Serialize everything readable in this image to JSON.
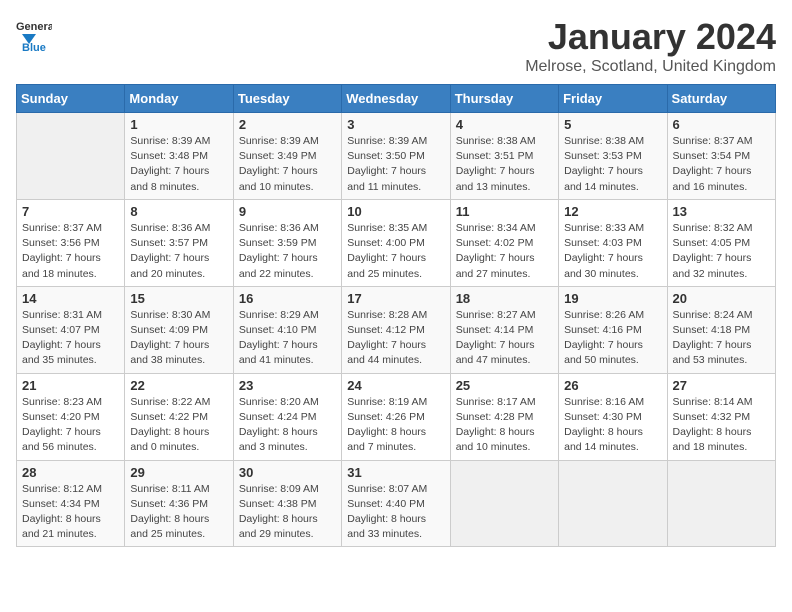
{
  "logo": {
    "text_general": "General",
    "text_blue": "Blue"
  },
  "header": {
    "month_title": "January 2024",
    "location": "Melrose, Scotland, United Kingdom"
  },
  "weekdays": [
    "Sunday",
    "Monday",
    "Tuesday",
    "Wednesday",
    "Thursday",
    "Friday",
    "Saturday"
  ],
  "weeks": [
    [
      {
        "day": "",
        "sunrise": "",
        "sunset": "",
        "daylight": ""
      },
      {
        "day": "1",
        "sunrise": "Sunrise: 8:39 AM",
        "sunset": "Sunset: 3:48 PM",
        "daylight": "Daylight: 7 hours and 8 minutes."
      },
      {
        "day": "2",
        "sunrise": "Sunrise: 8:39 AM",
        "sunset": "Sunset: 3:49 PM",
        "daylight": "Daylight: 7 hours and 10 minutes."
      },
      {
        "day": "3",
        "sunrise": "Sunrise: 8:39 AM",
        "sunset": "Sunset: 3:50 PM",
        "daylight": "Daylight: 7 hours and 11 minutes."
      },
      {
        "day": "4",
        "sunrise": "Sunrise: 8:38 AM",
        "sunset": "Sunset: 3:51 PM",
        "daylight": "Daylight: 7 hours and 13 minutes."
      },
      {
        "day": "5",
        "sunrise": "Sunrise: 8:38 AM",
        "sunset": "Sunset: 3:53 PM",
        "daylight": "Daylight: 7 hours and 14 minutes."
      },
      {
        "day": "6",
        "sunrise": "Sunrise: 8:37 AM",
        "sunset": "Sunset: 3:54 PM",
        "daylight": "Daylight: 7 hours and 16 minutes."
      }
    ],
    [
      {
        "day": "7",
        "sunrise": "Sunrise: 8:37 AM",
        "sunset": "Sunset: 3:56 PM",
        "daylight": "Daylight: 7 hours and 18 minutes."
      },
      {
        "day": "8",
        "sunrise": "Sunrise: 8:36 AM",
        "sunset": "Sunset: 3:57 PM",
        "daylight": "Daylight: 7 hours and 20 minutes."
      },
      {
        "day": "9",
        "sunrise": "Sunrise: 8:36 AM",
        "sunset": "Sunset: 3:59 PM",
        "daylight": "Daylight: 7 hours and 22 minutes."
      },
      {
        "day": "10",
        "sunrise": "Sunrise: 8:35 AM",
        "sunset": "Sunset: 4:00 PM",
        "daylight": "Daylight: 7 hours and 25 minutes."
      },
      {
        "day": "11",
        "sunrise": "Sunrise: 8:34 AM",
        "sunset": "Sunset: 4:02 PM",
        "daylight": "Daylight: 7 hours and 27 minutes."
      },
      {
        "day": "12",
        "sunrise": "Sunrise: 8:33 AM",
        "sunset": "Sunset: 4:03 PM",
        "daylight": "Daylight: 7 hours and 30 minutes."
      },
      {
        "day": "13",
        "sunrise": "Sunrise: 8:32 AM",
        "sunset": "Sunset: 4:05 PM",
        "daylight": "Daylight: 7 hours and 32 minutes."
      }
    ],
    [
      {
        "day": "14",
        "sunrise": "Sunrise: 8:31 AM",
        "sunset": "Sunset: 4:07 PM",
        "daylight": "Daylight: 7 hours and 35 minutes."
      },
      {
        "day": "15",
        "sunrise": "Sunrise: 8:30 AM",
        "sunset": "Sunset: 4:09 PM",
        "daylight": "Daylight: 7 hours and 38 minutes."
      },
      {
        "day": "16",
        "sunrise": "Sunrise: 8:29 AM",
        "sunset": "Sunset: 4:10 PM",
        "daylight": "Daylight: 7 hours and 41 minutes."
      },
      {
        "day": "17",
        "sunrise": "Sunrise: 8:28 AM",
        "sunset": "Sunset: 4:12 PM",
        "daylight": "Daylight: 7 hours and 44 minutes."
      },
      {
        "day": "18",
        "sunrise": "Sunrise: 8:27 AM",
        "sunset": "Sunset: 4:14 PM",
        "daylight": "Daylight: 7 hours and 47 minutes."
      },
      {
        "day": "19",
        "sunrise": "Sunrise: 8:26 AM",
        "sunset": "Sunset: 4:16 PM",
        "daylight": "Daylight: 7 hours and 50 minutes."
      },
      {
        "day": "20",
        "sunrise": "Sunrise: 8:24 AM",
        "sunset": "Sunset: 4:18 PM",
        "daylight": "Daylight: 7 hours and 53 minutes."
      }
    ],
    [
      {
        "day": "21",
        "sunrise": "Sunrise: 8:23 AM",
        "sunset": "Sunset: 4:20 PM",
        "daylight": "Daylight: 7 hours and 56 minutes."
      },
      {
        "day": "22",
        "sunrise": "Sunrise: 8:22 AM",
        "sunset": "Sunset: 4:22 PM",
        "daylight": "Daylight: 8 hours and 0 minutes."
      },
      {
        "day": "23",
        "sunrise": "Sunrise: 8:20 AM",
        "sunset": "Sunset: 4:24 PM",
        "daylight": "Daylight: 8 hours and 3 minutes."
      },
      {
        "day": "24",
        "sunrise": "Sunrise: 8:19 AM",
        "sunset": "Sunset: 4:26 PM",
        "daylight": "Daylight: 8 hours and 7 minutes."
      },
      {
        "day": "25",
        "sunrise": "Sunrise: 8:17 AM",
        "sunset": "Sunset: 4:28 PM",
        "daylight": "Daylight: 8 hours and 10 minutes."
      },
      {
        "day": "26",
        "sunrise": "Sunrise: 8:16 AM",
        "sunset": "Sunset: 4:30 PM",
        "daylight": "Daylight: 8 hours and 14 minutes."
      },
      {
        "day": "27",
        "sunrise": "Sunrise: 8:14 AM",
        "sunset": "Sunset: 4:32 PM",
        "daylight": "Daylight: 8 hours and 18 minutes."
      }
    ],
    [
      {
        "day": "28",
        "sunrise": "Sunrise: 8:12 AM",
        "sunset": "Sunset: 4:34 PM",
        "daylight": "Daylight: 8 hours and 21 minutes."
      },
      {
        "day": "29",
        "sunrise": "Sunrise: 8:11 AM",
        "sunset": "Sunset: 4:36 PM",
        "daylight": "Daylight: 8 hours and 25 minutes."
      },
      {
        "day": "30",
        "sunrise": "Sunrise: 8:09 AM",
        "sunset": "Sunset: 4:38 PM",
        "daylight": "Daylight: 8 hours and 29 minutes."
      },
      {
        "day": "31",
        "sunrise": "Sunrise: 8:07 AM",
        "sunset": "Sunset: 4:40 PM",
        "daylight": "Daylight: 8 hours and 33 minutes."
      },
      {
        "day": "",
        "sunrise": "",
        "sunset": "",
        "daylight": ""
      },
      {
        "day": "",
        "sunrise": "",
        "sunset": "",
        "daylight": ""
      },
      {
        "day": "",
        "sunrise": "",
        "sunset": "",
        "daylight": ""
      }
    ]
  ]
}
